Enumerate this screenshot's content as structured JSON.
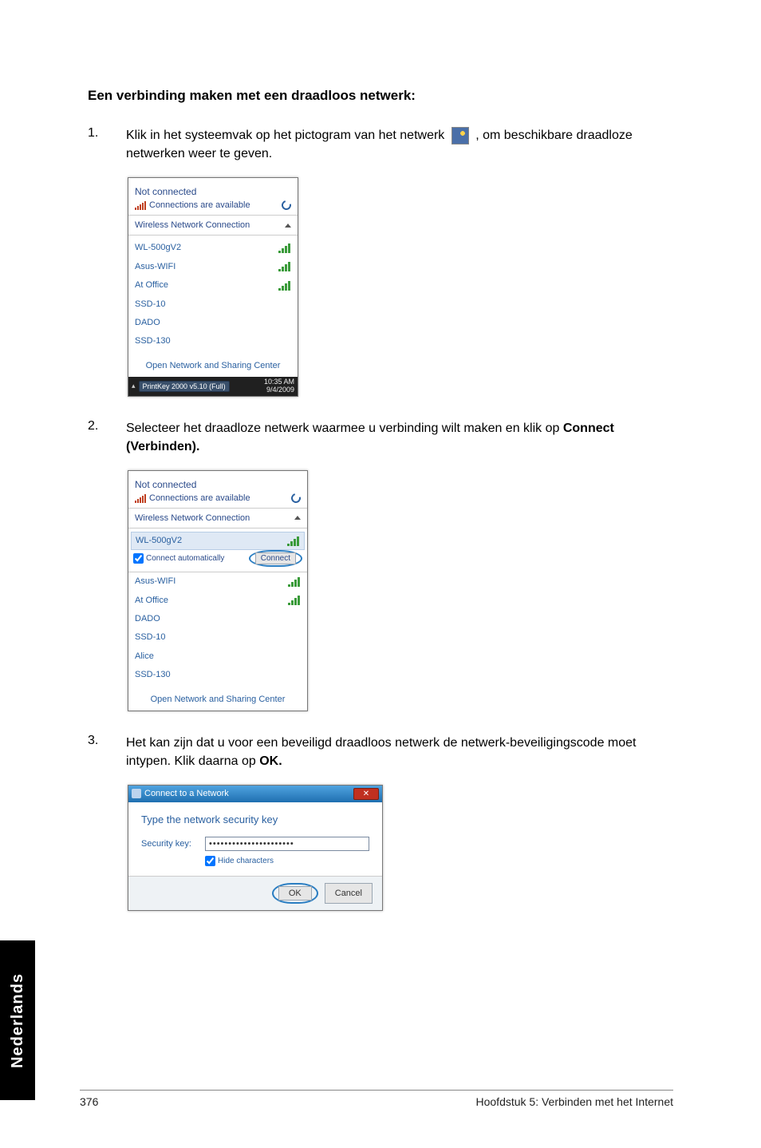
{
  "side_tab": "Nederlands",
  "heading": "Een verbinding maken met een draadloos netwerk:",
  "steps": {
    "s1": {
      "num": "1.",
      "before": "Klik in het systeemvak op het pictogram van het netwerk ",
      "after": " , om beschikbare draadloze netwerken weer te geven."
    },
    "s2": {
      "num": "2.",
      "text_a": "Selecteer het draadloze netwerk waarmee u verbinding wilt maken en klik op ",
      "text_b": "Connect (Verbinden)."
    },
    "s3": {
      "num": "3.",
      "text_a": "Het kan zijn dat u voor een beveiligd draadloos netwerk de netwerk-beveiligingscode moet intypen. Klik daarna op ",
      "text_b": "OK."
    }
  },
  "popup1": {
    "status": "Not connected",
    "avail": "Connections are available",
    "section": "Wireless Network Connection",
    "items": [
      "WL-500gV2",
      "Asus-WIFI",
      "At Office",
      "SSD-10",
      "DADO",
      "SSD-130"
    ],
    "footer_link": "Open Network and Sharing Center",
    "tb_btn": "PrintKey 2000 v5.10 (Full)",
    "tb_time": "10:35 AM",
    "tb_date": "9/4/2009"
  },
  "popup2": {
    "status": "Not connected",
    "avail": "Connections are available",
    "section": "Wireless Network Connection",
    "selected": "WL-500gV2",
    "auto_label": "Connect automatically",
    "connect": "Connect",
    "items": [
      "Asus-WIFI",
      "At Office",
      "DADO",
      "SSD-10",
      "Alice",
      "SSD-130"
    ],
    "footer_link": "Open Network and Sharing Center"
  },
  "dialog": {
    "title": "Connect to a Network",
    "prompt": "Type the network security key",
    "label": "Security key:",
    "value": "••••••••••••••••••••••",
    "hide": "Hide characters",
    "ok": "OK",
    "cancel": "Cancel"
  },
  "footer": {
    "page": "376",
    "chapter": "Hoofdstuk 5: Verbinden met het Internet"
  }
}
